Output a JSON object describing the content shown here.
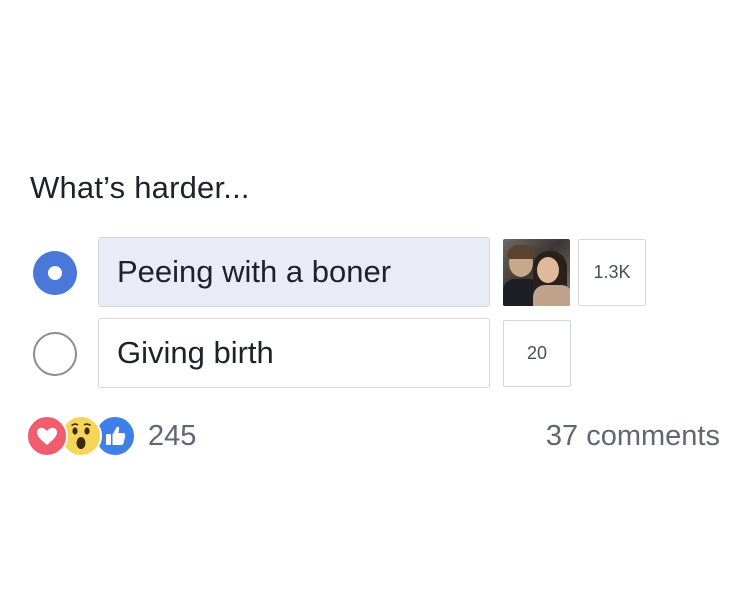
{
  "poll": {
    "question": "What’s harder...",
    "options": [
      {
        "label": "Peeing with a boner",
        "selected": true,
        "votes": "1.3K"
      },
      {
        "label": "Giving birth",
        "selected": false,
        "votes": "20"
      }
    ]
  },
  "reactions": {
    "icons": [
      "love-icon",
      "wow-icon",
      "like-icon"
    ],
    "count": "245"
  },
  "comments": {
    "label": "37 comments"
  },
  "colors": {
    "accent": "#4a78d8",
    "selected_fill": "#e9ebf7",
    "love": "#ef5d6e",
    "wow": "#f7d556",
    "like": "#3f7fe8"
  }
}
